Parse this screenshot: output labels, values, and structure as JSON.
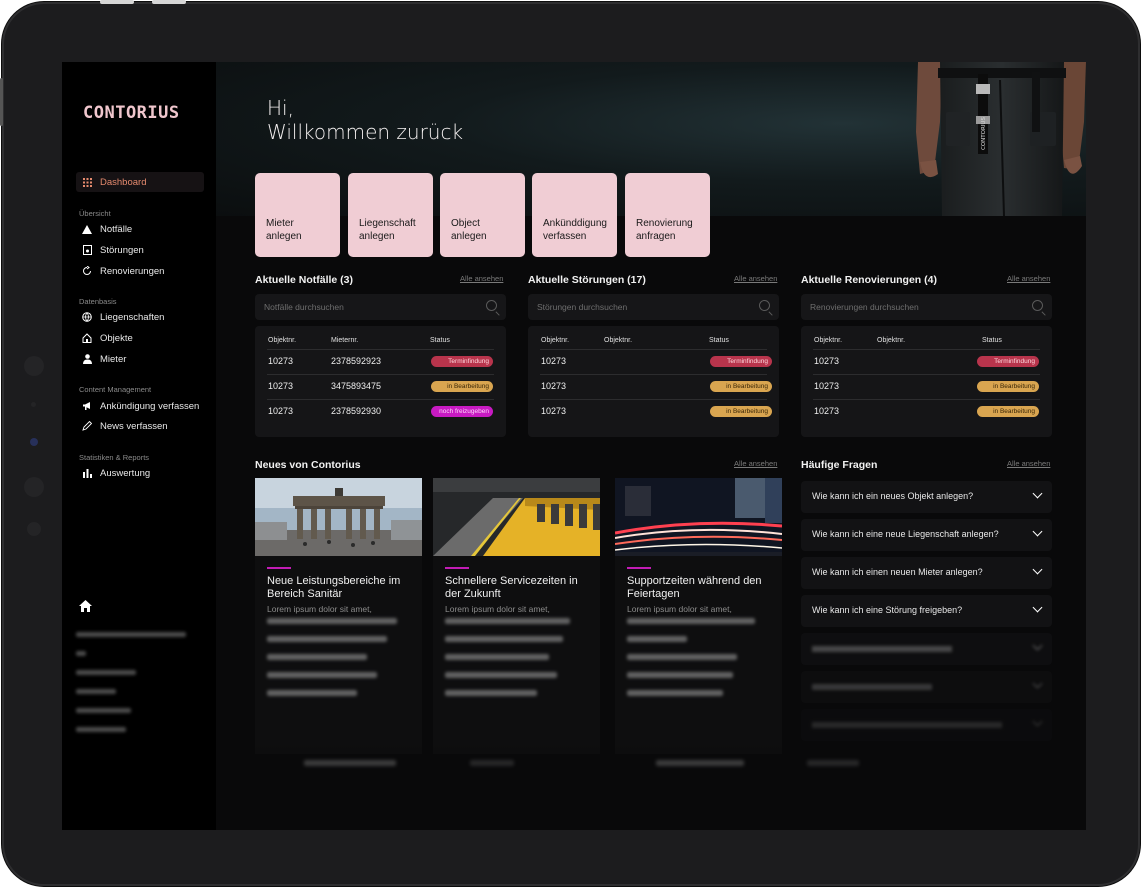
{
  "brand": "CONTORIUS",
  "greeting": {
    "line1": "Hi,",
    "line2": "Willkommen zurück"
  },
  "sidebar": {
    "active": {
      "label": "Dashboard",
      "icon": "grid-icon"
    },
    "sections": [
      {
        "label": "Übersicht",
        "items": [
          {
            "label": "Notfälle",
            "icon": "warning-icon"
          },
          {
            "label": "Störungen",
            "icon": "document-alert-icon"
          },
          {
            "label": "Renovierungen",
            "icon": "refresh-icon"
          }
        ]
      },
      {
        "label": "Datenbasis",
        "items": [
          {
            "label": "Liegenschaften",
            "icon": "globe-icon"
          },
          {
            "label": "Objekte",
            "icon": "house-icon"
          },
          {
            "label": "Mieter",
            "icon": "person-icon"
          }
        ]
      },
      {
        "label": "Content Management",
        "items": [
          {
            "label": "Ankündigung verfassen",
            "icon": "megaphone-icon"
          },
          {
            "label": "News verfassen",
            "icon": "pencil-icon"
          }
        ]
      },
      {
        "label": "Statistiken & Reports",
        "items": [
          {
            "label": "Auswertung",
            "icon": "bar-chart-icon"
          }
        ]
      }
    ]
  },
  "actions": [
    {
      "line1": "Mieter",
      "line2": "anlegen"
    },
    {
      "line1": "Liegenschaft",
      "line2": "anlegen"
    },
    {
      "line1": "Object",
      "line2": "anlegen"
    },
    {
      "line1": "Ankünddigung",
      "line2": "verfassen"
    },
    {
      "line1": "Renovierung",
      "line2": "anfragen"
    }
  ],
  "see_all": "Alle ansehen",
  "panels": [
    {
      "title": "Aktuelle Notfälle (3)",
      "search_placeholder": "Notfälle durchsuchen",
      "headers": [
        "Objektnr.",
        "Mieternr.",
        "Status"
      ],
      "rows": [
        {
          "c1": "10273",
          "c2": "2378592923",
          "status": "Terminfindung",
          "color": "#b8344c"
        },
        {
          "c1": "10273",
          "c2": "3475893475",
          "status": "in Bearbeitung",
          "color": "#d9a550"
        },
        {
          "c1": "10273",
          "c2": "2378592930",
          "status": "noch freizugeben",
          "color": "#c81ac3"
        }
      ]
    },
    {
      "title": "Aktuelle Störungen (17)",
      "search_placeholder": "Störungen durchsuchen",
      "headers": [
        "Objektnr.",
        "Objektnr.",
        "Status"
      ],
      "rows": [
        {
          "c1": "10273",
          "c2": "",
          "status": "Terminfindung",
          "color": "#b8344c"
        },
        {
          "c1": "10273",
          "c2": "",
          "status": "in Bearbeitung",
          "color": "#d9a550"
        },
        {
          "c1": "10273",
          "c2": "",
          "status": "in Bearbeitung",
          "color": "#d9a550"
        }
      ]
    },
    {
      "title": "Aktuelle Renovierungen (4)",
      "search_placeholder": "Renovierungen durchsuchen",
      "headers": [
        "Objektnr.",
        "Objektnr.",
        "Status"
      ],
      "rows": [
        {
          "c1": "10273",
          "c2": "",
          "status": "Terminfindung",
          "color": "#b8344c"
        },
        {
          "c1": "10273",
          "c2": "",
          "status": "in Bearbeitung",
          "color": "#d9a550"
        },
        {
          "c1": "10273",
          "c2": "",
          "status": "in Bearbeitung",
          "color": "#d9a550"
        }
      ]
    }
  ],
  "news": {
    "title": "Neues von Contorius",
    "items": [
      {
        "title": "Neue Leistungsbereiche im Bereich Sanitär",
        "excerpt": "Lorem ipsum dolor sit amet,"
      },
      {
        "title": "Schnellere Servicezeiten in der Zukunft",
        "excerpt": "Lorem ipsum dolor sit amet,"
      },
      {
        "title": "Supportzeiten während den Feiertagen",
        "excerpt": "Lorem ipsum dolor sit amet,"
      }
    ]
  },
  "faq": {
    "title": "Häufige Fragen",
    "items": [
      "Wie kann ich ein neues Objekt anlegen?",
      "Wie kann ich eine neue Liegenschaft anlegen?",
      "Wie kann ich einen neuen Mieter anlegen?",
      "Wie kann ich eine Störung freigeben?"
    ]
  },
  "hero_logo": "CONTORIUS",
  "colors": {
    "accent": "#f0cdd4",
    "active": "#e58a6e",
    "danger": "#b8344c",
    "warning": "#d9a550",
    "magenta": "#c81ac3"
  }
}
